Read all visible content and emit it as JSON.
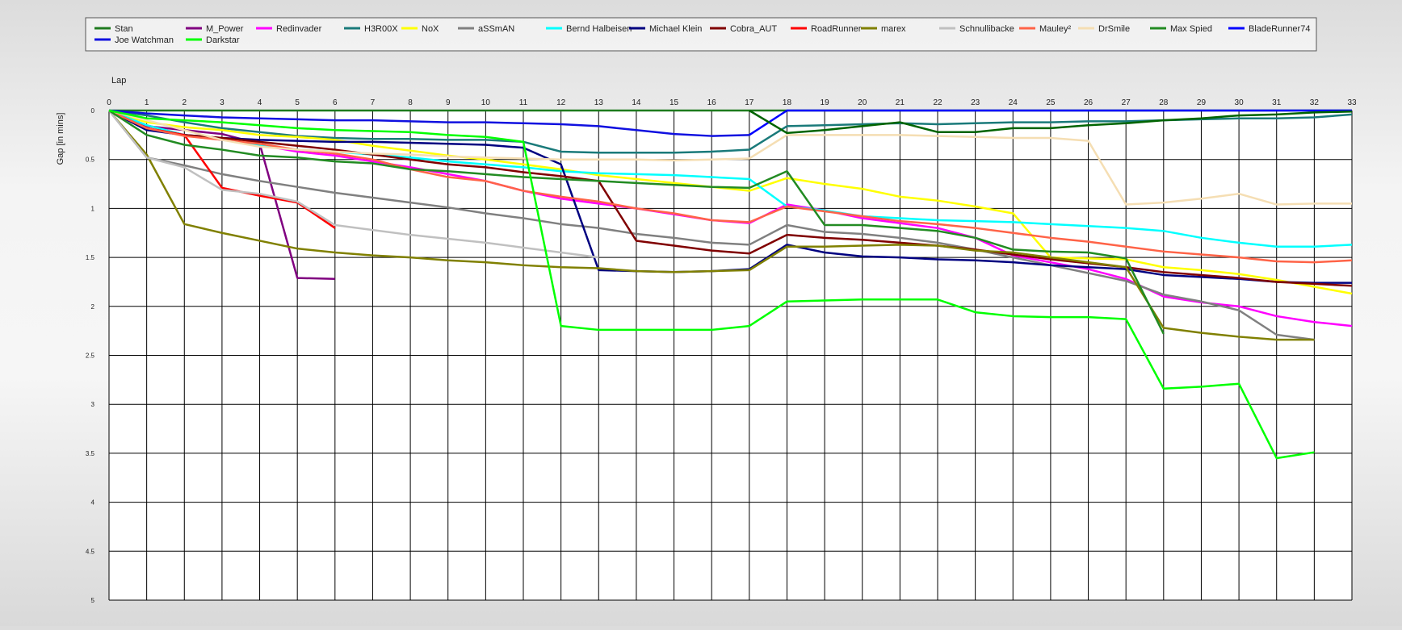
{
  "chart_data": {
    "type": "line",
    "title": "",
    "xlabel": "Lap",
    "ylabel": "Gap [in mins]",
    "xlim": [
      0,
      33
    ],
    "ylim": [
      0,
      5
    ],
    "y_inverted": true,
    "grid": true,
    "legend_position": "top",
    "x_ticks": [
      "0",
      "1",
      "2",
      "3",
      "4",
      "5",
      "6",
      "7",
      "8",
      "9",
      "10",
      "11",
      "12",
      "13",
      "14",
      "15",
      "16",
      "17",
      "18",
      "19",
      "20",
      "21",
      "22",
      "23",
      "24",
      "25",
      "26",
      "27",
      "28",
      "29",
      "30",
      "31",
      "32",
      "33"
    ],
    "y_ticks": [
      "0",
      "0.5",
      "1",
      "1.5",
      "2",
      "2.5",
      "3",
      "3.5",
      "4",
      "4.5",
      "5"
    ],
    "series": [
      {
        "name": "Stan",
        "color": "#1e7a1e",
        "x_start": 0,
        "values": [
          0,
          0,
          0,
          0,
          0,
          0,
          0,
          0,
          0,
          0,
          0,
          0,
          0,
          0,
          0,
          0,
          0,
          0,
          0,
          0,
          0,
          0,
          0,
          0,
          0,
          0,
          0,
          0,
          0,
          0,
          0,
          0,
          0,
          0
        ]
      },
      {
        "name": "M_Power",
        "color": "#800080",
        "x_start": 0,
        "values": [
          0,
          0.16,
          0.2,
          0.24,
          0.34,
          1.71,
          1.72
        ]
      },
      {
        "name": "Redinvader",
        "color": "#ff00ff",
        "x_start": 0,
        "values": [
          0,
          0.15,
          0.25,
          0.3,
          0.35,
          0.42,
          0.46,
          0.52,
          0.58,
          0.65,
          0.72,
          0.82,
          0.9,
          0.95,
          1.0,
          1.06,
          1.12,
          1.15,
          0.96,
          1.02,
          1.1,
          1.15,
          1.2,
          1.3,
          1.48,
          1.55,
          1.62,
          1.72,
          1.9,
          1.96,
          2.0,
          2.1,
          2.16,
          2.2
        ]
      },
      {
        "name": "H3R00X",
        "color": "#1a7a7a",
        "x_start": 0,
        "values": [
          0,
          0.05,
          0.12,
          0.18,
          0.22,
          0.26,
          0.28,
          0.29,
          0.29,
          0.3,
          0.3,
          0.32,
          0.42,
          0.43,
          0.43,
          0.43,
          0.42,
          0.4,
          0.16,
          0.15,
          0.14,
          0.13,
          0.14,
          0.13,
          0.12,
          0.12,
          0.11,
          0.11,
          0.1,
          0.09,
          0.08,
          0.08,
          0.07,
          0.04
        ]
      },
      {
        "name": "NoX",
        "color": "#ffff00",
        "x_start": 0,
        "values": [
          0,
          0.12,
          0.17,
          0.2,
          0.25,
          0.27,
          0.3,
          0.36,
          0.41,
          0.46,
          0.5,
          0.55,
          0.6,
          0.66,
          0.7,
          0.74,
          0.78,
          0.82,
          0.69,
          0.75,
          0.8,
          0.88,
          0.92,
          0.98,
          1.05,
          1.5,
          1.51,
          1.52,
          1.6,
          1.63,
          1.67,
          1.73,
          1.8,
          1.87
        ]
      },
      {
        "name": "aSSmAN",
        "color": "#808080",
        "x_start": 0,
        "values": [
          0,
          0.48,
          0.56,
          0.65,
          0.72,
          0.78,
          0.84,
          0.89,
          0.94,
          0.99,
          1.05,
          1.1,
          1.16,
          1.2,
          1.26,
          1.3,
          1.35,
          1.37,
          1.17,
          1.24,
          1.26,
          1.3,
          1.35,
          1.42,
          1.5,
          1.58,
          1.66,
          1.74,
          1.88,
          1.95,
          2.04,
          2.29,
          2.34
        ]
      },
      {
        "name": "Bernd Halbeisen",
        "color": "#00ffff",
        "x_start": 0,
        "values": [
          0,
          0.15,
          0.25,
          0.3,
          0.35,
          0.4,
          0.42,
          0.45,
          0.48,
          0.52,
          0.55,
          0.58,
          0.62,
          0.64,
          0.65,
          0.66,
          0.68,
          0.7,
          0.98,
          1.02,
          1.08,
          1.1,
          1.12,
          1.13,
          1.14,
          1.16,
          1.18,
          1.2,
          1.23,
          1.3,
          1.35,
          1.39,
          1.39,
          1.37
        ]
      },
      {
        "name": "Michael Klein",
        "color": "#000080",
        "x_start": 0,
        "values": [
          0,
          0.2,
          0.25,
          0.28,
          0.3,
          0.31,
          0.32,
          0.32,
          0.33,
          0.34,
          0.35,
          0.38,
          0.55,
          1.63,
          1.64,
          1.65,
          1.64,
          1.62,
          1.37,
          1.45,
          1.49,
          1.5,
          1.52,
          1.53,
          1.55,
          1.58,
          1.6,
          1.62,
          1.68,
          1.7,
          1.72,
          1.75,
          1.76,
          1.76
        ]
      },
      {
        "name": "Cobra_AUT",
        "color": "#800000",
        "x_start": 0,
        "values": [
          0,
          0.18,
          0.25,
          0.28,
          0.32,
          0.36,
          0.4,
          0.45,
          0.5,
          0.55,
          0.58,
          0.63,
          0.67,
          0.72,
          1.33,
          1.38,
          1.43,
          1.46,
          1.27,
          1.3,
          1.32,
          1.35,
          1.38,
          1.42,
          1.47,
          1.52,
          1.56,
          1.6,
          1.65,
          1.68,
          1.71,
          1.75,
          1.77,
          1.79
        ]
      },
      {
        "name": "RoadRunner",
        "color": "#ff0000",
        "x_start": 0,
        "values": [
          0,
          0.18,
          0.25,
          0.79,
          0.87,
          0.94,
          1.2
        ]
      },
      {
        "name": "marex",
        "color": "#808000",
        "x_start": 0,
        "values": [
          0,
          0.45,
          1.16,
          1.25,
          1.33,
          1.41,
          1.45,
          1.48,
          1.5,
          1.53,
          1.55,
          1.58,
          1.6,
          1.61,
          1.64,
          1.65,
          1.64,
          1.63,
          1.39,
          1.39,
          1.38,
          1.37,
          1.38,
          1.43,
          1.45,
          1.5,
          1.55,
          1.6,
          2.22,
          2.27,
          2.31,
          2.34,
          2.34
        ]
      },
      {
        "name": "Schnullibacke",
        "color": "#c0c0c0",
        "x_start": 0,
        "values": [
          0,
          0.48,
          0.58,
          0.81,
          0.85,
          0.93,
          1.17,
          1.22,
          1.27,
          1.31,
          1.35,
          1.4,
          1.45,
          1.5
        ]
      },
      {
        "name": "Mauley²",
        "color": "#ff6347",
        "x_start": 0,
        "values": [
          0,
          0.18,
          0.26,
          0.3,
          0.34,
          0.4,
          0.44,
          0.5,
          0.6,
          0.68,
          0.72,
          0.82,
          0.88,
          0.93,
          1.0,
          1.05,
          1.12,
          1.14,
          0.98,
          1.03,
          1.08,
          1.13,
          1.16,
          1.2,
          1.25,
          1.3,
          1.34,
          1.39,
          1.44,
          1.47,
          1.5,
          1.54,
          1.55,
          1.53
        ]
      },
      {
        "name": "DrSmile",
        "color": "#f5deb3",
        "x_start": 0,
        "values": [
          0,
          0.1,
          0.2,
          0.3,
          0.37,
          0.4,
          0.42,
          0.44,
          0.45,
          0.47,
          0.48,
          0.49,
          0.5,
          0.5,
          0.5,
          0.51,
          0.5,
          0.49,
          0.25,
          0.25,
          0.25,
          0.25,
          0.26,
          0.27,
          0.28,
          0.28,
          0.31,
          0.96,
          0.94,
          0.9,
          0.85,
          0.96,
          0.95,
          0.95
        ]
      },
      {
        "name": "Max Spied",
        "color": "#228b22",
        "x_start": 0,
        "values": [
          0,
          0.25,
          0.35,
          0.4,
          0.46,
          0.48,
          0.52,
          0.54,
          0.6,
          0.62,
          0.65,
          0.68,
          0.7,
          0.72,
          0.74,
          0.76,
          0.78,
          0.79,
          0.62,
          1.17,
          1.17,
          1.2,
          1.23,
          1.3,
          1.42,
          1.44,
          1.45,
          1.51,
          2.28
        ]
      },
      {
        "name": "BladeRunner74",
        "color": "#0000ff",
        "x_start": 17,
        "values": [
          0.25,
          0,
          0,
          0,
          0,
          0,
          0,
          0,
          0,
          0,
          0,
          0,
          0,
          0,
          0,
          0,
          0
        ]
      },
      {
        "name": "Joe Watchman",
        "color": "#1010e0",
        "x_start": 0,
        "values": [
          0,
          0.03,
          0.05,
          0.07,
          0.08,
          0.09,
          0.1,
          0.1,
          0.11,
          0.12,
          0.12,
          0.13,
          0.14,
          0.16,
          0.2,
          0.24,
          0.26,
          0.25
        ]
      },
      {
        "name": "Darkstar",
        "color": "#00ff00",
        "x_start": 0,
        "values": [
          0,
          0.08,
          0.1,
          0.12,
          0.15,
          0.18,
          0.2,
          0.21,
          0.22,
          0.25,
          0.27,
          0.32,
          2.2,
          2.24,
          2.24,
          2.24,
          2.24,
          2.2,
          1.95,
          1.94,
          1.93,
          1.93,
          1.93,
          2.06,
          2.1,
          2.11,
          2.11,
          2.13,
          2.84,
          2.82,
          2.79,
          3.55,
          3.49
        ]
      },
      {
        "name": "",
        "color": "#006400",
        "x_start": 17,
        "values": [
          0.0,
          0.23,
          0.2,
          0.16,
          0.12,
          0.22,
          0.22,
          0.18,
          0.18,
          0.15,
          0.13,
          0.1,
          0.08,
          0.05,
          0.04,
          0.02,
          0.01
        ]
      }
    ]
  }
}
